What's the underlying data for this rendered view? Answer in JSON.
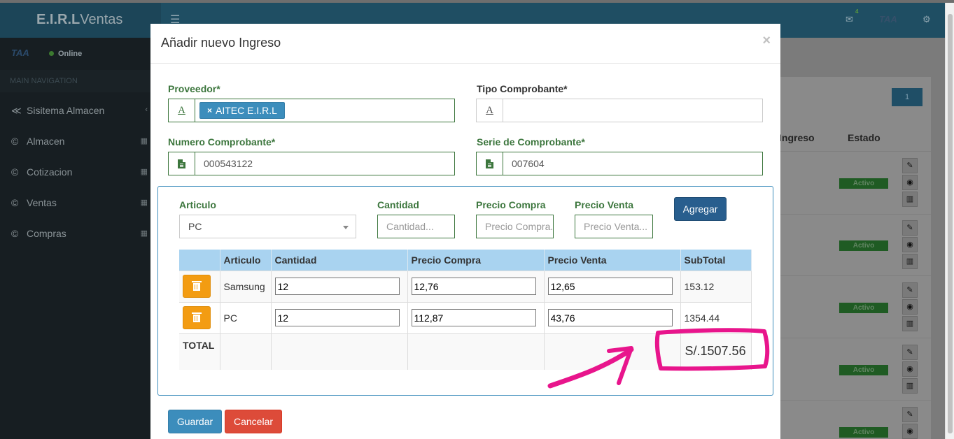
{
  "app": {
    "brand_bold": "E.I.R.L",
    "brand_rest": "Ventas",
    "notification_count": "4"
  },
  "sidebar": {
    "logo": "TAA",
    "status": "Online",
    "header": "MAIN NAVIGATION",
    "items": [
      {
        "label": "Sisitema Almacen",
        "icon": "share-icon"
      },
      {
        "label": "Almacen",
        "icon": "copyright-icon"
      },
      {
        "label": "Cotizacion",
        "icon": "copyright-icon"
      },
      {
        "label": "Ventas",
        "icon": "copyright-icon"
      },
      {
        "label": "Compras",
        "icon": "copyright-icon"
      }
    ]
  },
  "background_table": {
    "page": "1",
    "columns": [
      "Ingreso",
      "Estado"
    ],
    "status_label": "Activo"
  },
  "modal": {
    "title": "Añadir nuevo Ingreso",
    "proveedor": {
      "label": "Proveedor*",
      "selected": "AITEC E.I.R.L"
    },
    "tipo_comprobante": {
      "label": "Tipo Comprobante*",
      "value": ""
    },
    "numero_comprobante": {
      "label": "Numero Comprobante*",
      "value": "000543122"
    },
    "serie_comprobante": {
      "label": "Serie de Comprobante*",
      "value": "007604"
    },
    "detalle_form": {
      "articulo_label": "Articulo",
      "articulo_value": "PC",
      "cantidad_label": "Cantidad",
      "cantidad_placeholder": "Cantidad...",
      "precio_compra_label": "Precio Compra",
      "precio_compra_placeholder": "Precio Compra...",
      "precio_venta_label": "Precio Venta",
      "precio_venta_placeholder": "Precio Venta...",
      "agregar_label": "Agregar"
    },
    "table": {
      "headers": [
        "",
        "Articulo",
        "Cantidad",
        "Precio Compra",
        "Precio Venta",
        "SubTotal"
      ],
      "rows": [
        {
          "articulo": "Samsung",
          "cantidad": "12",
          "precio_compra": "12,76",
          "precio_venta": "12,65",
          "subtotal": "153.12"
        },
        {
          "articulo": "PC",
          "cantidad": "12",
          "precio_compra": "112,87",
          "precio_venta": "43,76",
          "subtotal": "1354.44"
        }
      ],
      "total_label": "TOTAL",
      "total_value": "S/.1507.56"
    },
    "guardar_label": "Guardar",
    "cancelar_label": "Cancelar"
  },
  "annotation": {
    "color": "#e8158c"
  }
}
